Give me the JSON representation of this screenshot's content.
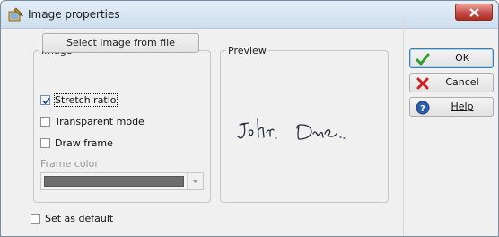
{
  "window": {
    "title": "Image properties"
  },
  "image_group": {
    "legend": "Image",
    "select_button": "Select image from file",
    "stretch_ratio": {
      "label": "Stretch ratio",
      "checked": true
    },
    "transparent_mode": {
      "label": "Transparent mode",
      "checked": false
    },
    "draw_frame": {
      "label": "Draw frame",
      "checked": false
    },
    "frame_color_label": "Frame color",
    "frame_color_value": "#6e6e6e"
  },
  "preview_group": {
    "legend": "Preview"
  },
  "buttons": {
    "ok": "OK",
    "cancel": "Cancel",
    "help": "Help"
  },
  "set_as_default": {
    "label": "Set as default",
    "checked": false
  },
  "colors": {
    "close_button": "#c75050",
    "ok_check": "#2d9d2d",
    "cancel_x": "#d01f1f",
    "help_icon": "#2f5fa8"
  },
  "icons": [
    "app-icon",
    "close-icon",
    "check-icon",
    "cancel-x-icon",
    "help-icon",
    "chevron-down-icon"
  ]
}
